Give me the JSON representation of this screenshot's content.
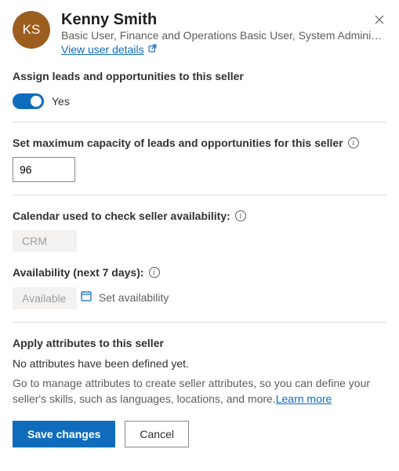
{
  "header": {
    "avatar_initials": "KS",
    "name": "Kenny Smith",
    "roles": "Basic User, Finance and Operations Basic User, System Administr…",
    "view_link": "View user details"
  },
  "assign": {
    "title": "Assign leads and opportunities to this seller",
    "toggle_on": true,
    "toggle_label": "Yes"
  },
  "capacity": {
    "title": "Set maximum capacity of leads and opportunities for this seller",
    "value": "96"
  },
  "calendar": {
    "title": "Calendar used to check seller availability:",
    "value": "CRM"
  },
  "availability": {
    "title": "Availability (next 7 days):",
    "value": "Available",
    "set_link": "Set availability"
  },
  "attributes": {
    "title": "Apply attributes to this seller",
    "empty": "No attributes have been defined yet.",
    "hint": "Go to manage attributes to create seller attributes, so you can define your seller's skills, such as languages, locations, and more.",
    "learn_more": "Learn more"
  },
  "footer": {
    "save": "Save changes",
    "cancel": "Cancel"
  }
}
